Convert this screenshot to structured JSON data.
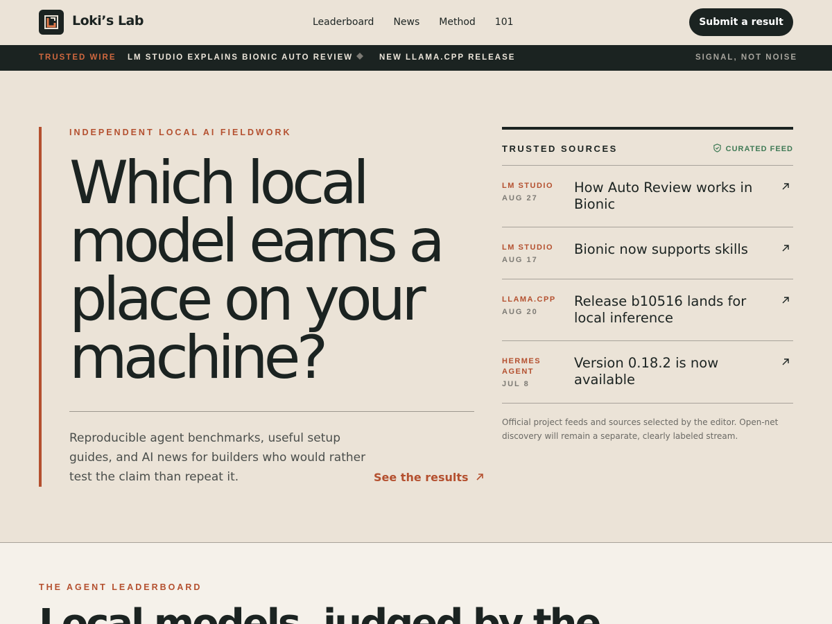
{
  "header": {
    "brand": "Loki’s Lab",
    "nav": [
      "Leaderboard",
      "News",
      "Method",
      "101"
    ],
    "submit_label": "Submit a result"
  },
  "wire": {
    "label": "TRUSTED WIRE",
    "items": [
      "LM STUDIO EXPLAINS BIONIC AUTO REVIEW",
      "NEW LLAMA.CPP RELEASE"
    ],
    "motto": "SIGNAL, NOT NOISE"
  },
  "hero": {
    "eyebrow": "INDEPENDENT LOCAL AI FIELDWORK",
    "headline_lines": [
      "Which local",
      "model earns a",
      "place on your",
      "machine?"
    ],
    "description": "Reproducible agent benchmarks, useful setup guides, and AI news for builders who would rather test the claim than repeat it.",
    "cta": "See the results"
  },
  "sources": {
    "title": "TRUSTED SOURCES",
    "badge": "CURATED FEED",
    "items": [
      {
        "source": "LM STUDIO",
        "date": "AUG 27",
        "title": "How Auto Review works in Bionic"
      },
      {
        "source": "LM STUDIO",
        "date": "AUG 17",
        "title": "Bionic now supports skills"
      },
      {
        "source": "LLAMA.CPP",
        "date": "AUG 20",
        "title": "Release b10516 lands for local inference"
      },
      {
        "source": "HERMES AGENT",
        "date": "JUL 8",
        "title": "Version 0.18.2 is now available"
      }
    ],
    "note": "Official project feeds and sources selected by the editor. Open-net discovery will remain a separate, clearly labeled stream."
  },
  "leaderboard": {
    "eyebrow": "THE AGENT LEADERBOARD",
    "title": "Local models, judged by the"
  },
  "colors": {
    "accent": "#b4502f",
    "ink": "#1b2321",
    "background": "#ebe3d7",
    "curated": "#3f7a55"
  }
}
